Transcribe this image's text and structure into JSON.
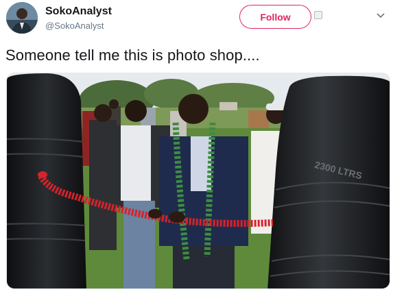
{
  "account": {
    "display_name": "SokoAnalyst",
    "handle": "@SokoAnalyst",
    "avatar_icon": "profile-avatar"
  },
  "actions": {
    "follow_label": "Follow",
    "follow_color": "#e0245e",
    "more_icon": "chevron-down-icon"
  },
  "tweet": {
    "text": "Someone tell me this is photo shop...."
  },
  "photo": {
    "tank_label": "2300 LTRS"
  }
}
